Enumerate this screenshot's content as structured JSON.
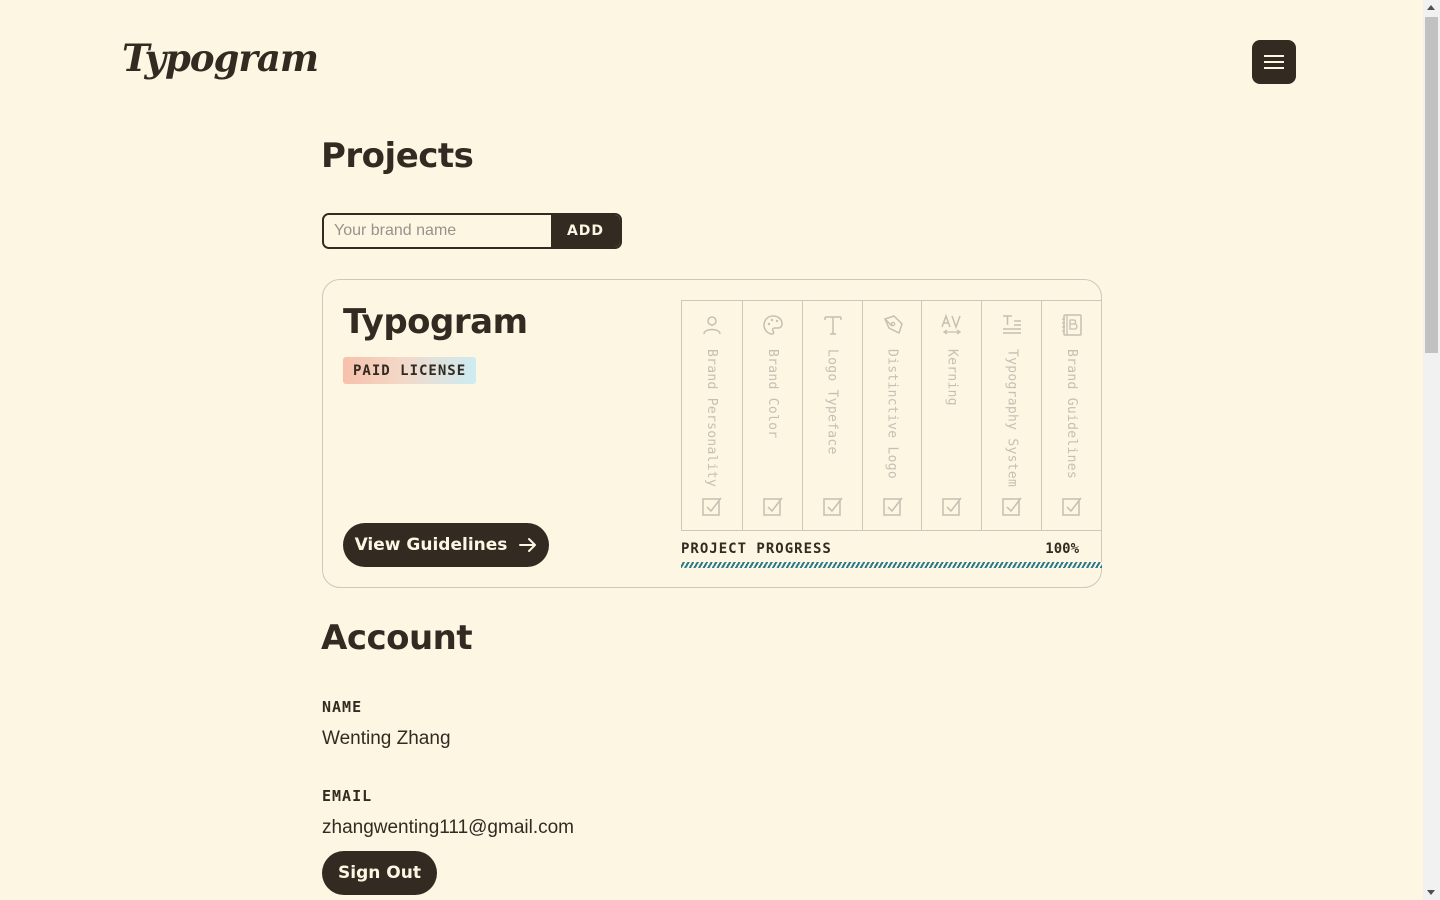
{
  "header": {
    "logo_text": "Typogram",
    "menu_icon": "hamburger-icon"
  },
  "projects": {
    "title": "Projects",
    "input_placeholder": "Your brand name",
    "add_label": "ADD",
    "items": [
      {
        "name": "Typogram",
        "license": "PAID LICENSE",
        "button_label": "View Guidelines",
        "steps": [
          {
            "label": "Brand Personality",
            "icon": "person-icon",
            "done": true
          },
          {
            "label": "Brand Color",
            "icon": "palette-icon",
            "done": true
          },
          {
            "label": "Logo Typeface",
            "icon": "typeface-icon",
            "done": true
          },
          {
            "label": "Distinctive Logo",
            "icon": "pen-nib-icon",
            "done": true
          },
          {
            "label": "Kerning",
            "icon": "kerning-icon",
            "done": true
          },
          {
            "label": "Typography System",
            "icon": "text-lines-icon",
            "done": true
          },
          {
            "label": "Brand Guidelines",
            "icon": "book-icon",
            "done": true
          }
        ],
        "progress_label": "PROJECT PROGRESS",
        "progress_text": "100%",
        "progress_value": 1.0
      }
    ]
  },
  "account": {
    "title": "Account",
    "name_label": "NAME",
    "name_value": "Wenting Zhang",
    "email_label": "EMAIL",
    "email_value": "zhangwenting111@gmail.com",
    "signout_label": "Sign Out"
  },
  "colors": {
    "background": "#fdf6e3",
    "ink": "#332a22",
    "muted": "#c7bfb2",
    "progress": "#2b7a8c"
  }
}
